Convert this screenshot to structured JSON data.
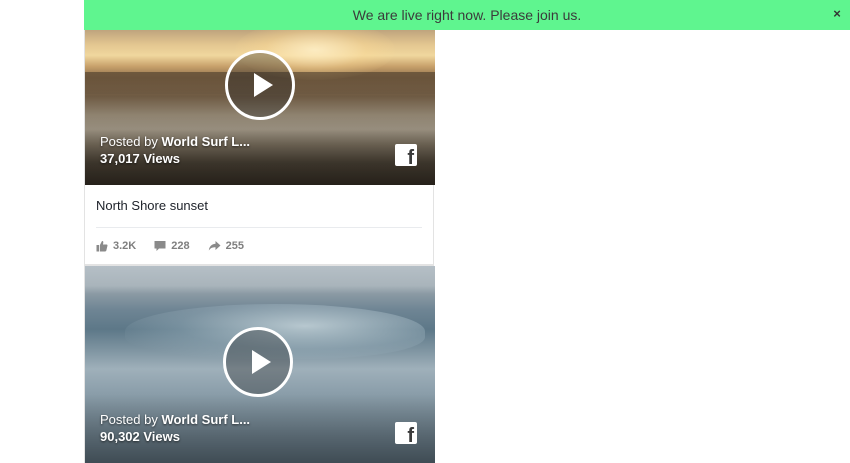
{
  "banner": {
    "message": "We are live right now. Please join us.",
    "close_label": "×",
    "background_color": "#5ff58f"
  },
  "feed": {
    "posts": [
      {
        "posted_by_prefix": "Posted by",
        "author": "World Surf L...",
        "views": "37,017 Views",
        "caption": "North Shore sunset",
        "likes": "3.2K",
        "comments": "228",
        "shares": "255",
        "play_icon": "play-icon",
        "platform_icon": "facebook-icon"
      },
      {
        "posted_by_prefix": "Posted by",
        "author": "World Surf L...",
        "views": "90,302 Views",
        "play_icon": "play-icon",
        "platform_icon": "facebook-icon"
      }
    ]
  },
  "icons": {
    "like": "thumbs-up-icon",
    "comment": "comment-icon",
    "share": "share-arrow-icon",
    "close": "close-icon"
  },
  "colors": {
    "stats_text": "#7f7f7f",
    "caption_text": "#1d2129",
    "overlay_text": "#ffffff"
  }
}
